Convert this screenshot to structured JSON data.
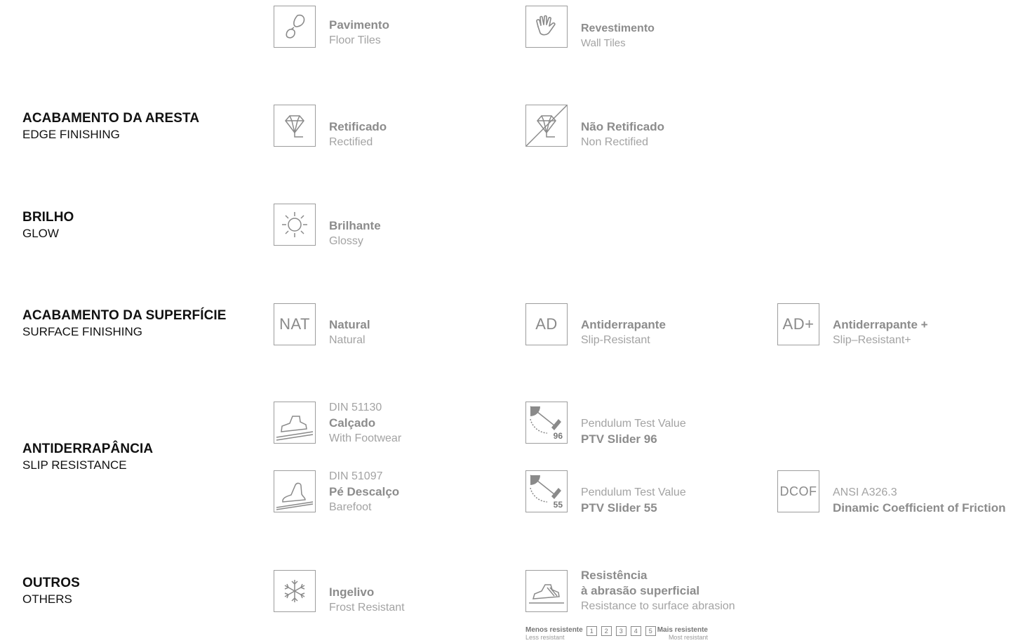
{
  "sections": {
    "edge": {
      "pt": "ACABAMENTO DA ARESTA",
      "en": "EDGE FINISHING"
    },
    "glow": {
      "pt": "BRILHO",
      "en": "GLOW"
    },
    "surface": {
      "pt": "ACABAMENTO DA SUPERFÍCIE",
      "en": "SURFACE FINISHING"
    },
    "slip": {
      "pt": "ANTIDERRAPÂNCIA",
      "en": "SLIP RESISTANCE"
    },
    "others": {
      "pt": "OUTROS",
      "en": "OTHERS"
    }
  },
  "items": {
    "floor": {
      "bold": "Pavimento",
      "sub": "Floor Tiles",
      "icon": "footprint-icon"
    },
    "wall": {
      "bold": "Revestimento",
      "sub": "Wall Tiles",
      "icon": "hand-icon"
    },
    "rectified": {
      "bold": "Retificado",
      "sub": "Rectified",
      "icon": "diamond-icon"
    },
    "non_rectified": {
      "bold": "Não Retificado",
      "sub": "Non Rectified",
      "icon": "diamond-crossed-icon"
    },
    "glossy": {
      "bold": "Brilhante",
      "sub": "Glossy",
      "icon": "sun-icon"
    },
    "natural": {
      "box": "NAT",
      "bold": "Natural",
      "sub": "Natural"
    },
    "ad": {
      "box": "AD",
      "bold": "Antiderrapante",
      "sub": "Slip-Resistant"
    },
    "ad_plus": {
      "box": "AD+",
      "bold": "Antiderrapante +",
      "sub": "Slip–Resistant+"
    },
    "footwear": {
      "top": "DIN 51130",
      "bold": "Calçado",
      "sub": "With Footwear",
      "icon": "shoe-ramp-icon"
    },
    "barefoot": {
      "top": "DIN 51097",
      "bold": "Pé Descalço",
      "sub": "Barefoot",
      "icon": "foot-ramp-icon"
    },
    "ptv96": {
      "top": "Pendulum Test Value",
      "bold": "PTV Slider 96",
      "badge": "96",
      "icon": "pendulum-icon"
    },
    "ptv55": {
      "top": "Pendulum Test Value",
      "bold": "PTV Slider 55",
      "badge": "55",
      "icon": "pendulum-icon"
    },
    "dcof": {
      "box": "DCOF",
      "top": "ANSI A326.3",
      "bold": "Dinamic Coefficient of Friction"
    },
    "frost": {
      "bold": "Ingelivo",
      "sub": "Frost Resistant",
      "icon": "snowflake-icon"
    },
    "abrasion": {
      "bold1": "Resistência",
      "bold2": "à abrasão superficial",
      "sub": "Resistance to surface abrasion",
      "icon": "abrasion-shoe-icon"
    }
  },
  "scale": {
    "less_pt": "Menos resistente",
    "less_en": "Less resistant",
    "more_pt": "Mais resistente",
    "more_en": "Most resistant",
    "levels": [
      "1",
      "2",
      "3",
      "4",
      "5"
    ]
  }
}
